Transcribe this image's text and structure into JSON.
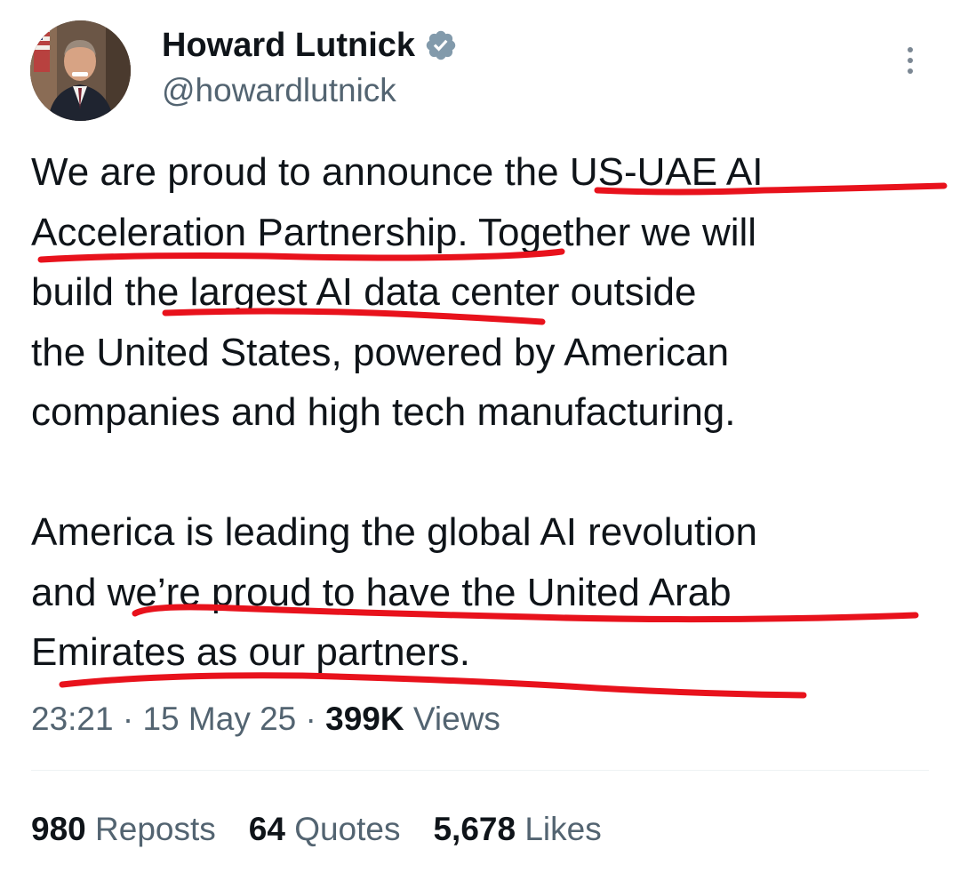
{
  "author": {
    "display_name": "Howard Lutnick",
    "handle": "@howardlutnick",
    "verified_icon": "verified-badge-icon",
    "avatar_icon": "profile-photo"
  },
  "tweet": {
    "lines": [
      "We are proud to announce the US-UAE AI",
      "Acceleration Partnership. Together we will",
      "build the largest AI data center outside",
      "the United States, powered by American",
      "companies and high tech manufacturing.",
      "",
      "America is leading the global AI revolution",
      "and we’re proud to have the United Arab",
      "Emirates as our partners."
    ]
  },
  "meta": {
    "time": "23:21",
    "separator": " · ",
    "date": "15 May 25",
    "views_count": "399K",
    "views_label": "Views"
  },
  "stats": {
    "reposts_count": "980",
    "reposts_label": "Reposts",
    "quotes_count": "64",
    "quotes_label": "Quotes",
    "likes_count": "5,678",
    "likes_label": "Likes"
  },
  "colors": {
    "text_primary": "#0f1419",
    "text_secondary": "#536471",
    "verified_badge": "#829aab",
    "annotation_red": "#e8121c",
    "divider": "#eff3f4"
  },
  "more_icon": "more-vertical-icon"
}
